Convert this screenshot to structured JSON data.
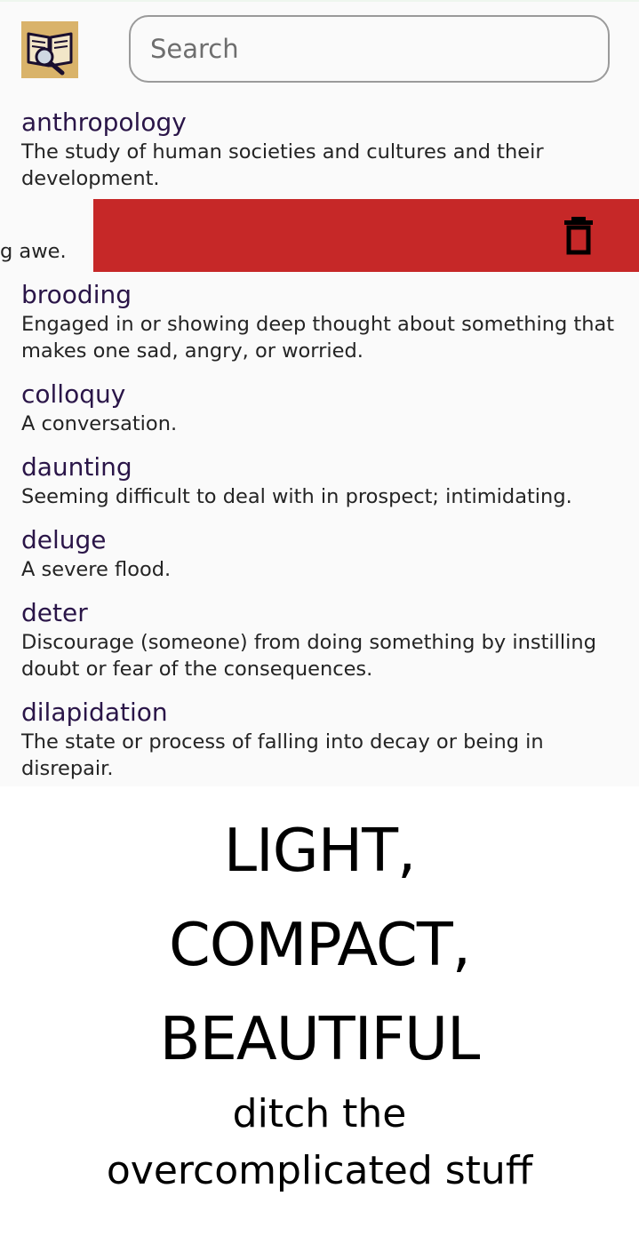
{
  "header": {
    "app_icon": "book-magnifier-icon",
    "search_placeholder": "Search",
    "search_value": ""
  },
  "entries": [
    {
      "word": "anthropology",
      "definition": "The study of human societies and cultures and their development."
    },
    {
      "word": "brooding",
      "definition": "Engaged in or showing deep thought about something that makes one sad, angry, or worried."
    },
    {
      "word": "colloquy",
      "definition": "A conversation."
    },
    {
      "word": "daunting",
      "definition": "Seeming difficult to deal with in prospect; intimidating."
    },
    {
      "word": "deluge",
      "definition": "A severe flood."
    },
    {
      "word": "deter",
      "definition": "Discourage (someone) from doing something by instilling doubt or fear of the consequences."
    },
    {
      "word": "dilapidation",
      "definition": "The state or process of falling into decay or being in disrepair."
    }
  ],
  "swiped_entry": {
    "visible_text": "g awe.",
    "action_icon": "trash-icon"
  },
  "colors": {
    "word": "#2a1548",
    "delete_background": "#c62828",
    "app_icon_background": "#d9b36a"
  },
  "promo": {
    "headline_lines": [
      "LIGHT,",
      "COMPACT,",
      "BEAUTIFUL"
    ],
    "tagline_lines": [
      "ditch the",
      "overcomplicated stuff"
    ]
  }
}
